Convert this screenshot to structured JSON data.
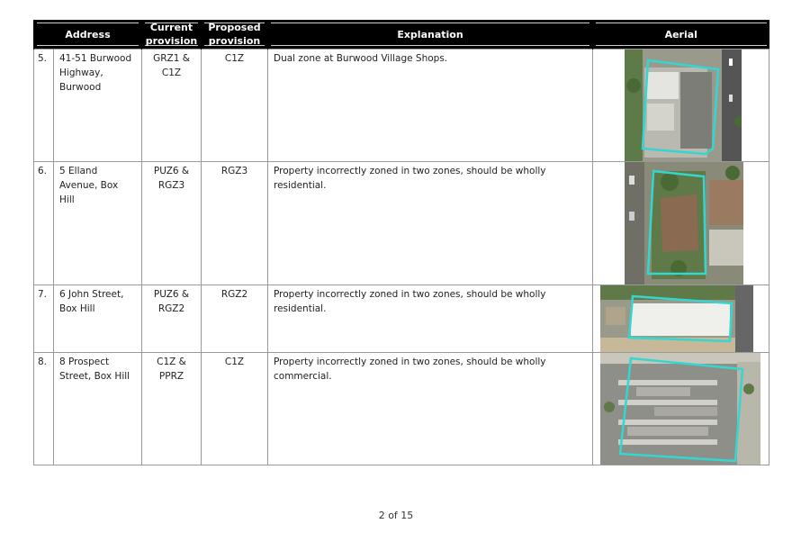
{
  "headers": {
    "address": "Address",
    "current": "Current provision",
    "proposed": "Proposed provision",
    "explanation": "Explanation",
    "aerial": "Aerial"
  },
  "rows": [
    {
      "num": "5.",
      "address": "41-51 Burwood Highway, Burwood",
      "current": "GRZ1 & C1Z",
      "proposed": "C1Z",
      "explanation": "Dual zone at Burwood Village Shops.",
      "image": "aerial-photo-burwood"
    },
    {
      "num": "6.",
      "address": "5 Elland Avenue, Box Hill",
      "current": "PUZ6 & RGZ3",
      "proposed": "RGZ3",
      "explanation": "Property incorrectly zoned in two zones, should be wholly residential.",
      "image": "aerial-photo-elland"
    },
    {
      "num": "7.",
      "address": "6 John Street, Box Hill",
      "current": "PUZ6 & RGZ2",
      "proposed": "RGZ2",
      "explanation": "Property incorrectly zoned in two zones, should be wholly residential.",
      "image": "aerial-photo-john"
    },
    {
      "num": "8.",
      "address": "8 Prospect Street, Box Hill",
      "current": "C1Z & PPRZ",
      "proposed": "C1Z",
      "explanation": "Property incorrectly zoned in two zones, should be wholly commercial.",
      "image": "aerial-photo-prospect"
    }
  ],
  "footer": "2 of 15",
  "colors": {
    "boundary": "#34d6d0",
    "header_bg": "#000000"
  }
}
